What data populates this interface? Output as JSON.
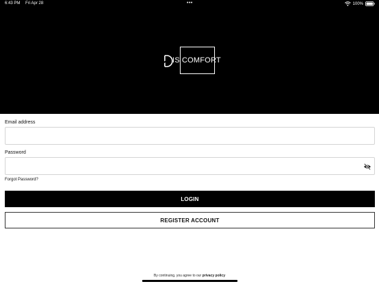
{
  "status_bar": {
    "time": "6:43 PM",
    "date": "Fri Apr 28",
    "dots": "•••",
    "battery": "100%",
    "wifi_icon": "wifi-icon",
    "battery_icon": "battery-icon"
  },
  "logo": {
    "dis": "IS",
    "comfort": "COMFORT",
    "mark_icon": "logo-d-mark"
  },
  "form": {
    "email_label": "Email address",
    "email_value": "",
    "email_placeholder": "",
    "password_label": "Password",
    "password_value": "",
    "password_placeholder": "",
    "eye_icon": "eye-off-icon",
    "forgot_label": "Forgot Password?"
  },
  "buttons": {
    "login_label": "LOGIN",
    "register_label": "REGISTER ACCOUNT"
  },
  "footer": {
    "prefix": "By continuing, you agree to our",
    "privacy_label": "privacy policy"
  },
  "colors": {
    "hero_bg": "#000000",
    "page_bg": "#ffffff",
    "primary_button": "#000000"
  }
}
